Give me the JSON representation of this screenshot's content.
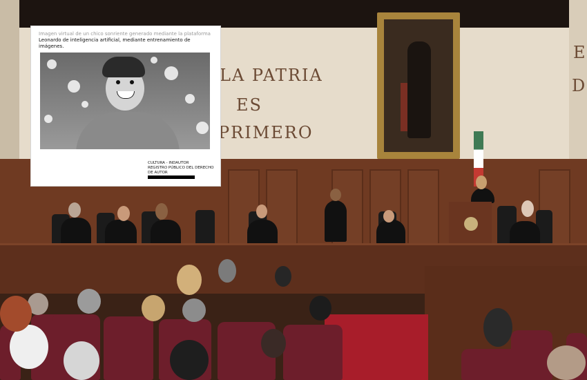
{
  "mural": {
    "line1": "LA PATRIA",
    "line2": "ES",
    "line3": "PRIMERO",
    "right_fragment_top": "EI",
    "right_fragment_bottom": "DE"
  },
  "overlay_document": {
    "caption_line1": "Imagen virtual de un chico sonriente generado mediante la plataforma",
    "caption_line2": "Leonardo de inteligencia artificial, mediante entrenamiento de",
    "caption_line3": "imágenes.",
    "stamp_line1": "CULTURA - INDAUTOR",
    "stamp_line2": "REGISTRO PÚBLICO DEL DERECHO",
    "stamp_line3": "DE AUTOR"
  },
  "colors": {
    "wood": "#6f3a22",
    "seats": "#6d1e2b",
    "carpet": "#a81d2a",
    "wall": "#e6dccb"
  }
}
